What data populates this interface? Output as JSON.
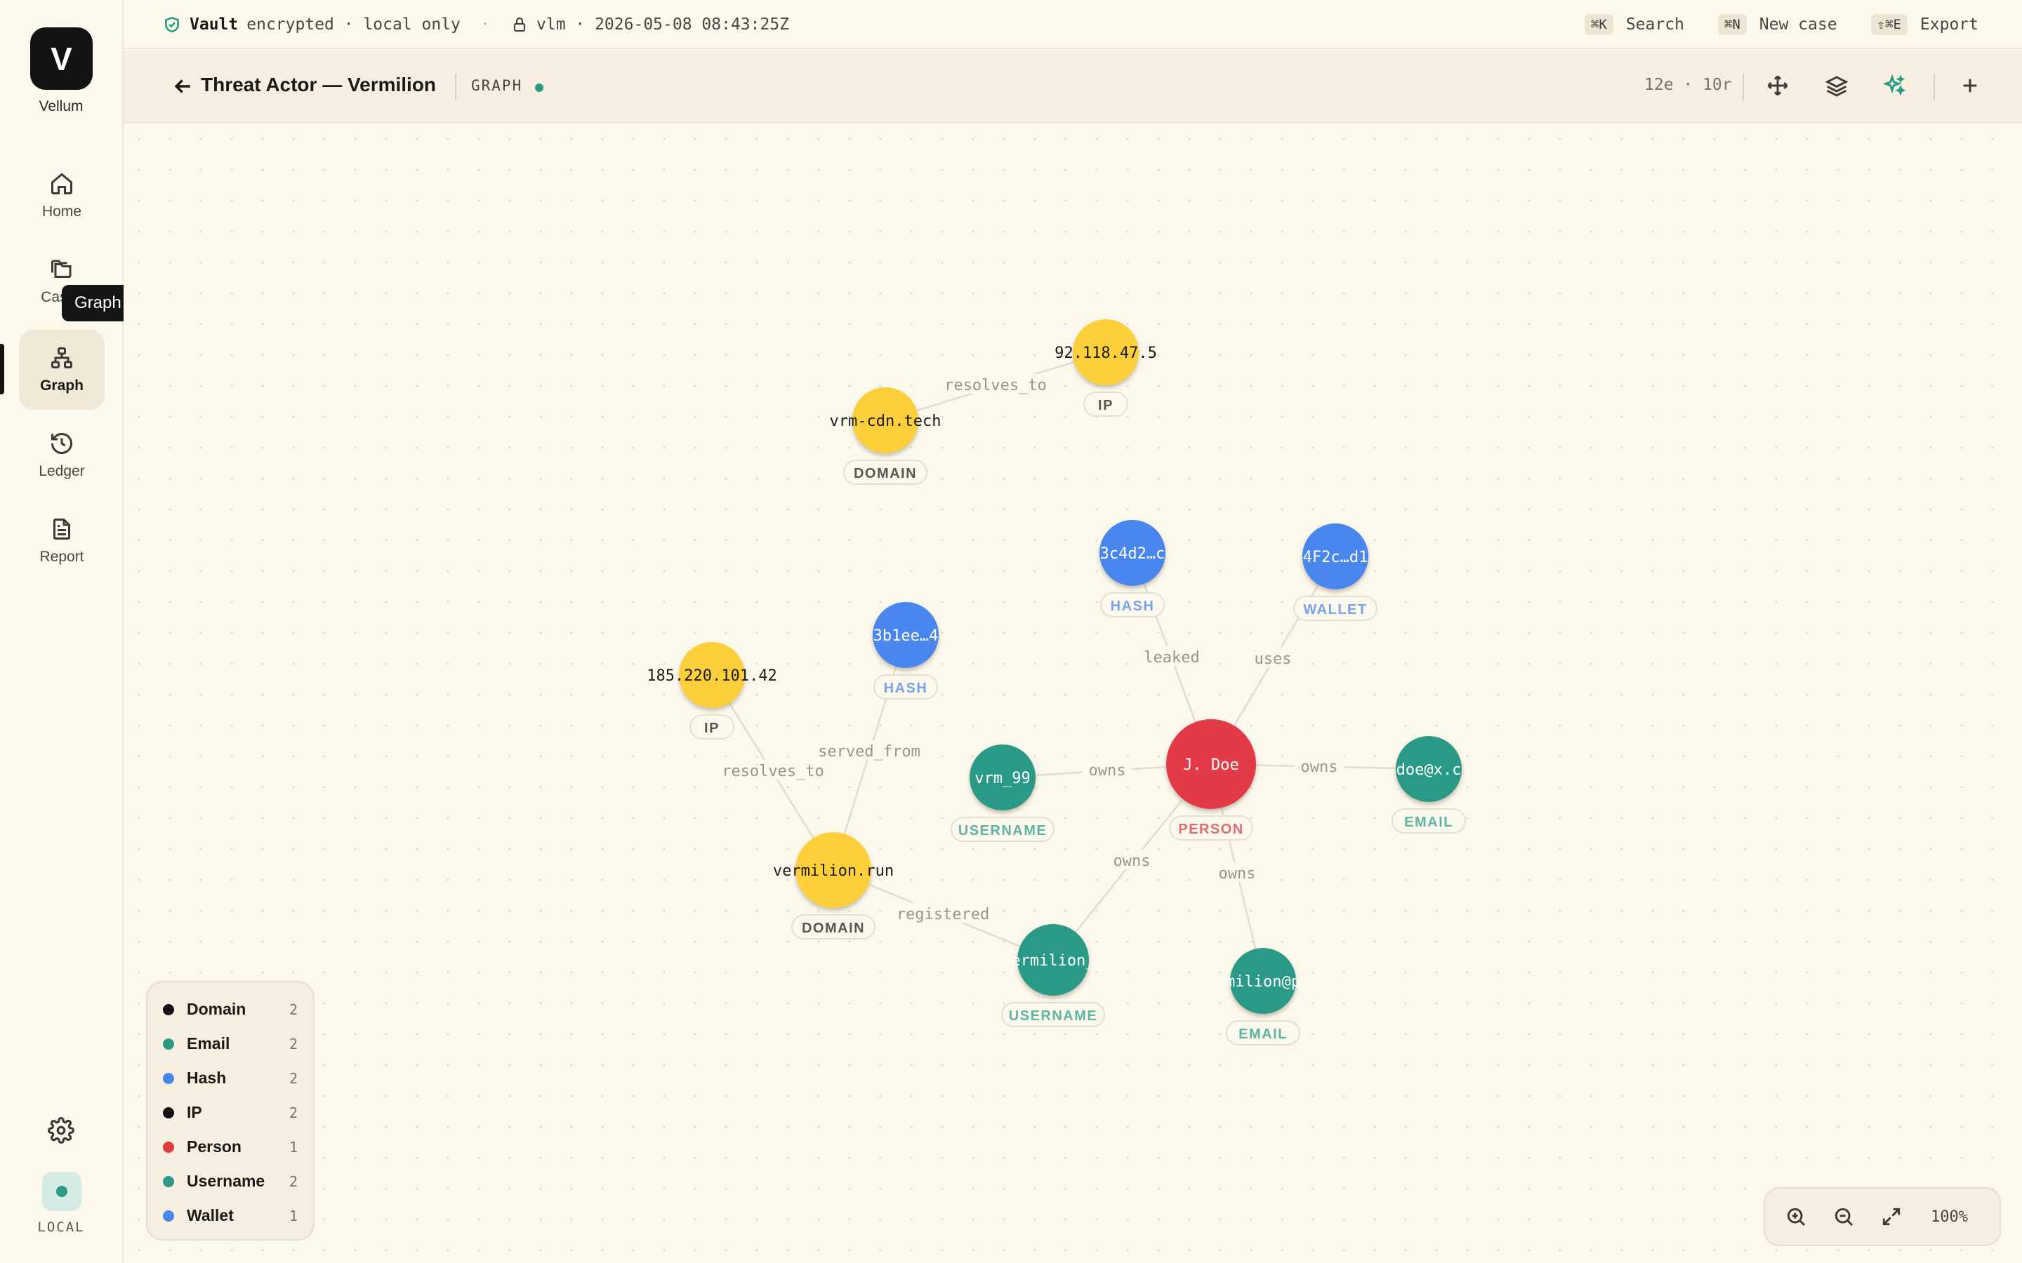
{
  "app": {
    "logo_letter": "V",
    "name": "Vellum"
  },
  "sidebar": {
    "items": [
      {
        "label": "Home",
        "icon": "home-icon"
      },
      {
        "label": "Cases",
        "icon": "folders-icon"
      },
      {
        "label": "Graph",
        "icon": "graph-icon",
        "active": true
      },
      {
        "label": "Ledger",
        "icon": "history-icon"
      },
      {
        "label": "Report",
        "icon": "document-icon"
      }
    ],
    "tooltip": "Graph",
    "settings_icon": "gear-icon",
    "local_label": "LOCAL"
  },
  "status_bar": {
    "vault_name": "Vault",
    "vault_status": "encrypted · local only",
    "separator": "·",
    "lock_info": "vlm · 2026-05-08 08:43:25Z",
    "shortcuts": [
      {
        "key": "⌘K",
        "label": "Search"
      },
      {
        "key": "⌘N",
        "label": "New case"
      },
      {
        "key": "⇧⌘E",
        "label": "Export"
      }
    ]
  },
  "header": {
    "title": "Threat Actor — Vermilion",
    "view_label": "GRAPH",
    "counts": "12e · 10r"
  },
  "colors": {
    "domain": "#fdd03a",
    "ip": "#fdd03a",
    "hash": "#4a86ee",
    "wallet": "#4a86ee",
    "person": "#e23a47",
    "username": "#2a9a86",
    "email": "#2a9a86",
    "accent": "#2a9a86"
  },
  "graph": {
    "nodes": [
      {
        "id": "n1",
        "label": "92.118.47.5",
        "type": "IP"
      },
      {
        "id": "n2",
        "label": "vrm-cdn.tech",
        "type": "DOMAIN"
      },
      {
        "id": "n3",
        "label": "3c4d2…c",
        "type": "HASH"
      },
      {
        "id": "n4",
        "label": "4F2c…d1",
        "type": "WALLET"
      },
      {
        "id": "n5",
        "label": "3b1ee…4",
        "type": "HASH"
      },
      {
        "id": "n6",
        "label": "185.220.101.42",
        "type": "IP"
      },
      {
        "id": "n7",
        "label": "J. Doe",
        "type": "PERSON"
      },
      {
        "id": "n8",
        "label": "vrm_99",
        "type": "USERNAME"
      },
      {
        "id": "n9",
        "label": "doe@x.c",
        "type": "EMAIL"
      },
      {
        "id": "n10",
        "label": "vermilion.run",
        "type": "DOMAIN"
      },
      {
        "id": "n11",
        "label": "ermilion_",
        "type": "USERNAME"
      },
      {
        "id": "n12",
        "label": "milion@p",
        "type": "EMAIL"
      }
    ],
    "edges": [
      {
        "from": "n2",
        "to": "n1",
        "label": "resolves_to"
      },
      {
        "from": "n7",
        "to": "n3",
        "label": "leaked"
      },
      {
        "from": "n7",
        "to": "n4",
        "label": "uses"
      },
      {
        "from": "n7",
        "to": "n8",
        "label": "owns"
      },
      {
        "from": "n7",
        "to": "n9",
        "label": "owns"
      },
      {
        "from": "n7",
        "to": "n11",
        "label": "owns"
      },
      {
        "from": "n7",
        "to": "n12",
        "label": "owns"
      },
      {
        "from": "n10",
        "to": "n5",
        "label": "served_from"
      },
      {
        "from": "n10",
        "to": "n6",
        "label": "resolves_to"
      },
      {
        "from": "n10",
        "to": "n11",
        "label": "registered"
      }
    ]
  },
  "legend": [
    {
      "name": "Domain",
      "count": "2",
      "color": "#121212"
    },
    {
      "name": "Email",
      "count": "2",
      "color": "#2a9a86"
    },
    {
      "name": "Hash",
      "count": "2",
      "color": "#4a86ee"
    },
    {
      "name": "IP",
      "count": "2",
      "color": "#121212"
    },
    {
      "name": "Person",
      "count": "1",
      "color": "#e23a47"
    },
    {
      "name": "Username",
      "count": "2",
      "color": "#2a9a86"
    },
    {
      "name": "Wallet",
      "count": "1",
      "color": "#4a86ee"
    }
  ],
  "zoom": {
    "level": "100%"
  }
}
